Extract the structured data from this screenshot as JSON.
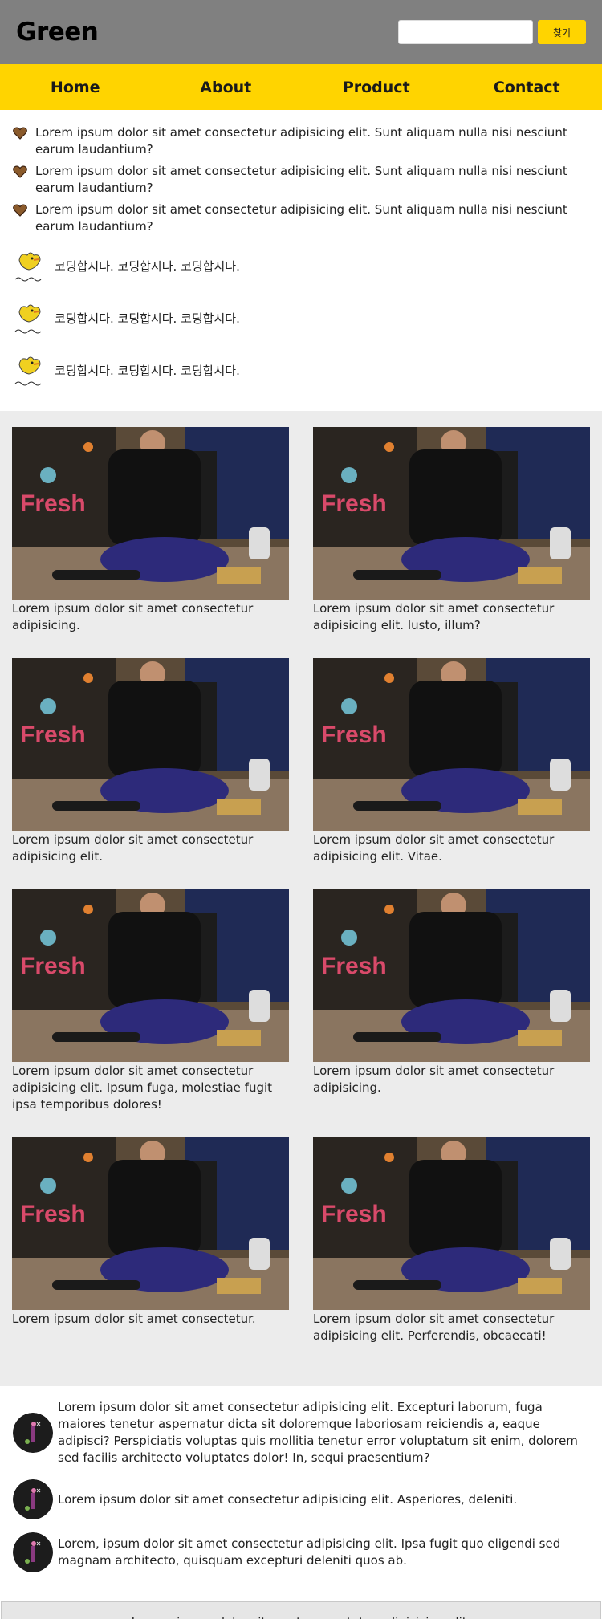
{
  "header": {
    "logo": "Green",
    "search_placeholder": "",
    "search_button": "찾기"
  },
  "nav": [
    "Home",
    "About",
    "Product",
    "Contact"
  ],
  "hearts": [
    "Lorem ipsum dolor sit amet consectetur adipisicing elit. Sunt aliquam nulla nisi nesciunt earum laudantium?",
    "Lorem ipsum dolor sit amet consectetur adipisicing elit. Sunt aliquam nulla nisi nesciunt earum laudantium?",
    "Lorem ipsum dolor sit amet consectetur adipisicing elit. Sunt aliquam nulla nisi nesciunt earum laudantium?"
  ],
  "birds": [
    "코딩합시다. 코딩합시다. 코딩합시다.",
    "코딩합시다. 코딩합시다. 코딩합시다.",
    "코딩합시다. 코딩합시다. 코딩합시다."
  ],
  "gallery": [
    "Lorem ipsum dolor sit amet consectetur adipisicing.",
    "Lorem ipsum dolor sit amet consectetur adipisicing elit. Iusto, illum?",
    "Lorem ipsum dolor sit amet consectetur adipisicing elit.",
    "Lorem ipsum dolor sit amet consectetur adipisicing elit. Vitae.",
    "Lorem ipsum dolor sit amet consectetur adipisicing elit. Ipsum fuga, molestiae fugit ipsa temporibus dolores!",
    "Lorem ipsum dolor sit amet consectetur adipisicing.",
    "Lorem ipsum dolor sit amet consectetur.",
    "Lorem ipsum dolor sit amet consectetur adipisicing elit. Perferendis, obcaecati!"
  ],
  "comments": [
    "Lorem ipsum dolor sit amet consectetur adipisicing elit. Excepturi laborum, fuga maiores tenetur aspernatur dicta sit doloremque laboriosam reiciendis a, eaque adipisci? Perspiciatis voluptas quis mollitia tenetur error voluptatum sit enim, dolorem sed facilis architecto voluptates dolor! In, sequi praesentium?",
    "Lorem ipsum dolor sit amet consectetur adipisicing elit. Asperiores, deleniti.",
    "Lorem, ipsum dolor sit amet consectetur adipisicing elit. Ipsa fugit quo eligendi sed magnam architecto, quisquam excepturi deleniti quos ab."
  ],
  "footer": "Lorem, ipsum dolor sit amet consectetur adipisicing elit.",
  "icons": {
    "heart": "heart-icon",
    "bird": "bird-logo-icon",
    "avatar": "avatar-image",
    "photo": "photo-image"
  },
  "colors": {
    "header_bg": "#808080",
    "accent": "#ffd400",
    "gallery_bg": "#ececec",
    "heart": "#8a5a2b"
  }
}
